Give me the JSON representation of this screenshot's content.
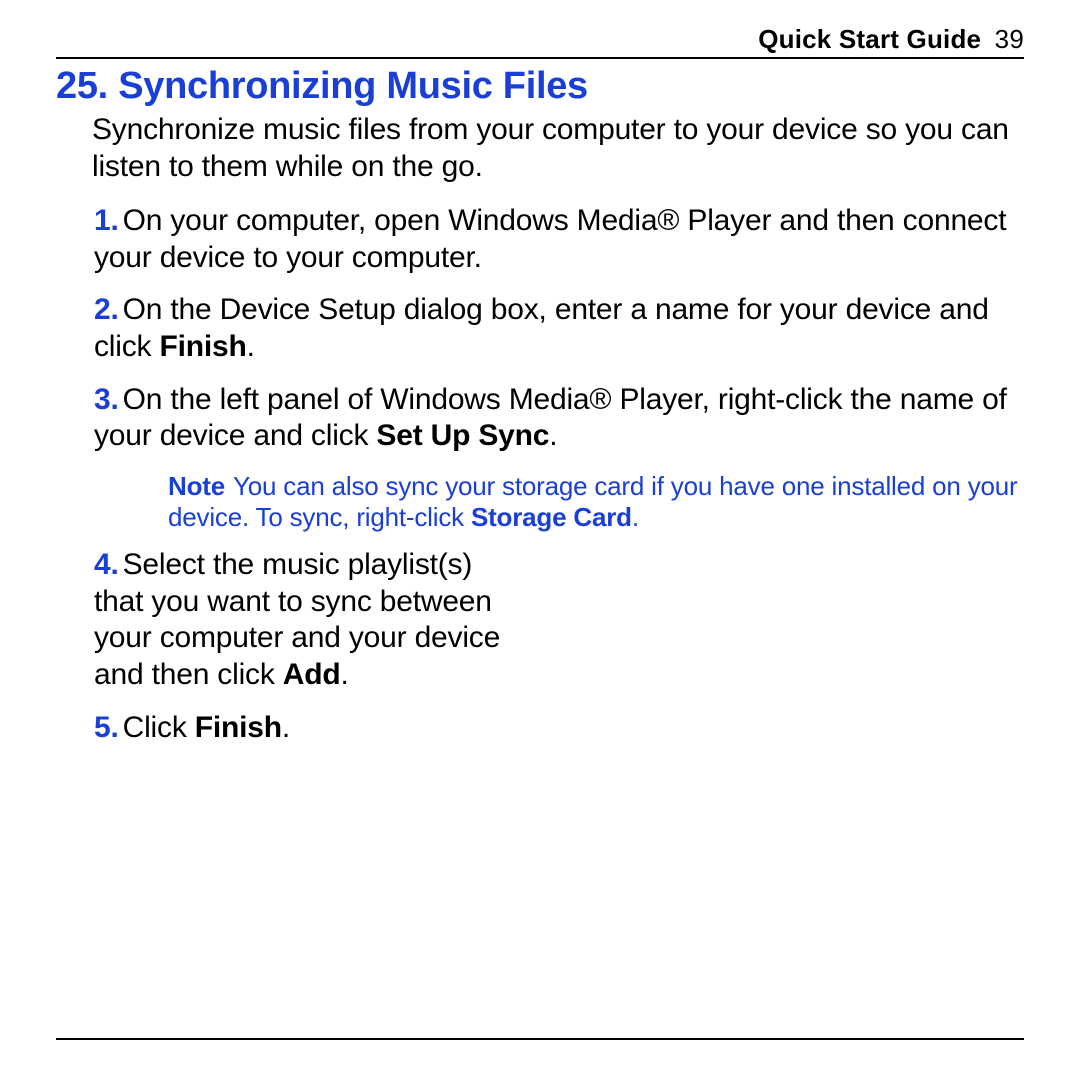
{
  "header": {
    "guide_label": "Quick Start Guide",
    "page_number": "39"
  },
  "section": {
    "number": "25.",
    "title": "Synchronizing Music Files"
  },
  "intro": "Synchronize music files from your computer to your device so you can listen to them while on the go.",
  "steps": {
    "s1": {
      "num": "1.",
      "text": "On your computer, open Windows Media® Player and then connect your device to your computer."
    },
    "s2": {
      "num": "2.",
      "pre": "On the Device Setup dialog box, enter a name for your device and click ",
      "bold": "Finish",
      "post": "."
    },
    "s3": {
      "num": "3.",
      "pre": "On the left panel of Windows Media® Player, right-click the name of your device and click ",
      "bold": "Set Up Sync",
      "post": "."
    },
    "note": {
      "label": "Note",
      "pre": "You can also sync your storage card if you have one installed on your device. To sync, right-click ",
      "bold": "Storage Card",
      "post": "."
    },
    "s4": {
      "num": "4.",
      "pre": "Select the music playlist(s) that you want to sync between your computer and your device and then click ",
      "bold": "Add",
      "post": "."
    },
    "s5": {
      "num": "5.",
      "pre": "Click ",
      "bold": "Finish",
      "post": "."
    }
  }
}
